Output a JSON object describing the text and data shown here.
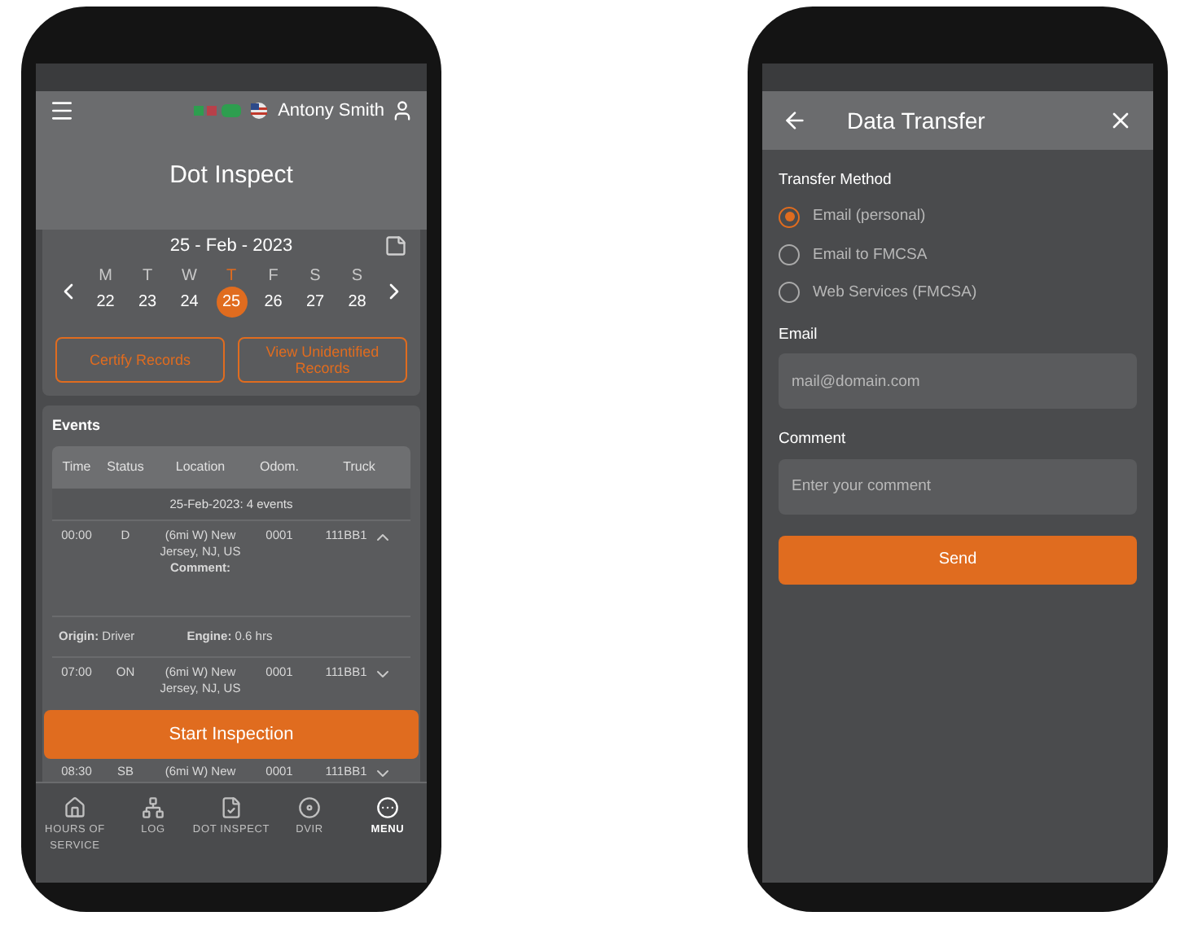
{
  "left_screen": {
    "header": {
      "user_name": "Antony Smith",
      "title": "Dot Inspect"
    },
    "date": "25 - Feb - 2023",
    "week": [
      {
        "letter": "M",
        "number": "22",
        "selected": false
      },
      {
        "letter": "T",
        "number": "23",
        "selected": false
      },
      {
        "letter": "W",
        "number": "24",
        "selected": false
      },
      {
        "letter": "T",
        "number": "25",
        "selected": true
      },
      {
        "letter": "F",
        "number": "26",
        "selected": false
      },
      {
        "letter": "S",
        "number": "27",
        "selected": false
      },
      {
        "letter": "S",
        "number": "28",
        "selected": false
      }
    ],
    "record_buttons": [
      "Certify Records",
      "View Unidentified Records"
    ],
    "events": {
      "title": "Events",
      "columns": [
        "Time",
        "Status",
        "Location",
        "Odom.",
        "Truck"
      ],
      "group_label": "25-Feb-2023: 4 events",
      "rows": [
        {
          "time": "00:00",
          "status": "D",
          "location": "(6mi W) New Jersey, NJ, US",
          "comment_label": "Comment:",
          "odometer": "0001",
          "truck": "111BB1",
          "expanded": true,
          "origin": "**Origin:** Driver",
          "engine": "**Engine:** 0.6 hrs"
        },
        {
          "time": "07:00",
          "status": "ON",
          "location": "(6mi W) New Jersey, NJ, US",
          "odometer": "0001",
          "truck": "111BB1",
          "expanded": false
        },
        {
          "time": "08:30",
          "status": "SB",
          "location": "(6mi W) New",
          "odometer": "0001",
          "truck": "111BB1",
          "expanded": false
        }
      ]
    },
    "start_button": "Start Inspection",
    "nav": [
      {
        "kind": "hours",
        "label": "HOURS OF SERVICE",
        "selected": false
      },
      {
        "kind": "log",
        "label": "LOG",
        "selected": false
      },
      {
        "kind": "dot",
        "label": "DOT INSPECT",
        "selected": false
      },
      {
        "kind": "dvir",
        "label": "DVIR",
        "selected": false
      },
      {
        "kind": "menu",
        "label": "MENU",
        "selected": true
      }
    ]
  },
  "right_screen": {
    "title": "Data Transfer",
    "method_label": "Transfer Method",
    "options": [
      {
        "label": "Email (personal)",
        "selected": true
      },
      {
        "label": "Email to FMCSA",
        "selected": false
      },
      {
        "label": "Web Services (FMCSA)",
        "selected": false
      }
    ],
    "email": {
      "label": "Email",
      "placeholder": "mail@domain.com"
    },
    "comment": {
      "label": "Comment",
      "placeholder": "Enter your comment"
    },
    "send_button": "Send"
  }
}
